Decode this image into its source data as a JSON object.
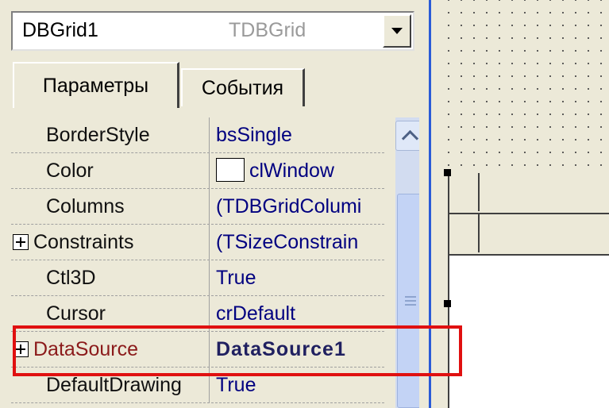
{
  "component_selector": {
    "name": "DBGrid1",
    "type": "TDBGrid"
  },
  "tabs": [
    {
      "label": "Параметры",
      "active": true
    },
    {
      "label": "События",
      "active": false
    }
  ],
  "properties": [
    {
      "name": "BorderStyle",
      "value": "bsSingle",
      "expandable": false
    },
    {
      "name": "Color",
      "value": "clWindow",
      "expandable": false,
      "swatch": "#ffffff"
    },
    {
      "name": "Columns",
      "value": "(TDBGridColumi",
      "expandable": false
    },
    {
      "name": "Constraints",
      "value": "(TSizeConstrain",
      "expandable": true
    },
    {
      "name": "Ctl3D",
      "value": "True",
      "expandable": false
    },
    {
      "name": "Cursor",
      "value": "crDefault",
      "expandable": false
    },
    {
      "name": "DataSource",
      "value": "DataSource1",
      "expandable": true,
      "highlighted": true
    },
    {
      "name": "DefaultDrawing",
      "value": "True",
      "expandable": false
    }
  ],
  "colors": {
    "highlight_box": "#e01010",
    "value_text": "#000080",
    "reference_property": "#8b1a1a"
  },
  "icons": {
    "dropdown": "chevron-down-icon",
    "scroll_up": "chevron-up-icon",
    "expand": "plus-icon"
  }
}
